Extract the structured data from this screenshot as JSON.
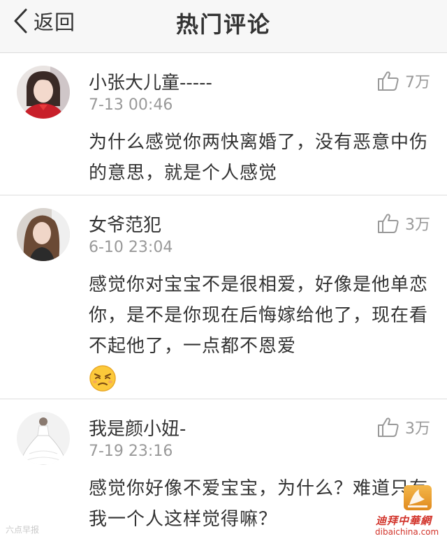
{
  "header": {
    "back_label": "返回",
    "title": "热门评论"
  },
  "comments": [
    {
      "username": "小张大儿童-----",
      "time": "7-13 00:46",
      "likes": "7万",
      "text": "为什么感觉你两快离婚了，没有恶意中伤的意思，就是个人感觉",
      "avatar_icon": "avatar-girl-red-dress"
    },
    {
      "username": "女爷范犯",
      "time": "6-10 23:04",
      "likes": "3万",
      "text": "感觉你对宝宝不是很相爱，好像是他单恋你，是不是你现在后悔嫁给他了，现在看不起他了，一点都不恩爱",
      "emoji": "smirk-emoji",
      "avatar_icon": "avatar-long-hair"
    },
    {
      "username": "我是颜小妞-",
      "time": "7-19 23:16",
      "likes": "3万",
      "text": "感觉你好像不爱宝宝，为什么？难道只有我一个人这样觉得嘛？",
      "avatar_icon": "avatar-wedding-dress"
    }
  ],
  "icons": {
    "like": "thumbs-up-icon",
    "back": "chevron-left-icon"
  },
  "watermark": {
    "left": "六点早报",
    "brand_cn": "迪拜中華網",
    "domain": "dibaichina.com"
  },
  "colors": {
    "header_bg": "#f7f7f7",
    "text": "#333333",
    "muted": "#999999",
    "divider": "#dedede",
    "brand_red": "#d2342b"
  }
}
